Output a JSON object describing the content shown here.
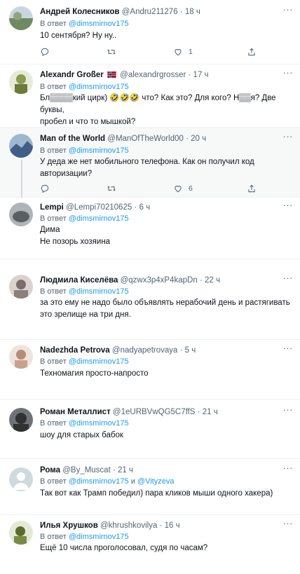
{
  "reply_to_label": "В ответ",
  "tweets": [
    {
      "name": "Андрей Колесников",
      "handle": "@Andru211276",
      "time": "18 ч",
      "reply_to": [
        "@dimsmirnov175"
      ],
      "lines": [
        "10 сентября? Ну ну.."
      ],
      "likes": "1",
      "avatar_colors": [
        "#6f8a62",
        "#c9d6e0"
      ]
    },
    {
      "name": "Alexandr Großer",
      "handle": "@alexandrgrosser",
      "time": "17 ч",
      "reply_to": [
        "@dimsmirnov175"
      ],
      "lines": [
        "Бл▒▒▒▒кий цирк) 🤣🤣🤣 что? Как это? Для кого? Н▒▒я? Две буквы,",
        "пробел и что то мышкой?"
      ],
      "likes": "",
      "avatar_colors": [
        "#8a9a4e",
        "#e6ebd8"
      ]
    },
    {
      "name": "Man of the World",
      "handle": "@ManOfTheWorld00",
      "time": "20 ч",
      "reply_to": [
        "@dimsmirnov175"
      ],
      "lines": [
        "У деда же нет мобильного телефона. Как он получил код",
        "авторизации?"
      ],
      "likes": "6",
      "avatar_colors": [
        "#3f5f86",
        "#9fb7d1"
      ]
    },
    {
      "name": "Lempi",
      "handle": "@Lempi70210625",
      "time": "6 ч",
      "reply_to": [
        "@dimsmirnov175"
      ],
      "lines": [
        "Дима",
        "Не позорь хозяина"
      ],
      "likes": "",
      "avatar_colors": [
        "#5a5f63",
        "#aeb4b8"
      ]
    },
    {
      "name": "Людмила Киселёва",
      "handle": "@qzwx3p4xP4kapDn",
      "time": "22 ч",
      "reply_to": [
        "@dimsmirnov175"
      ],
      "lines": [
        "за это ему не надо было объявлять нерабочий день и растягивать",
        "это зрелище на три дня."
      ],
      "likes": "",
      "avatar_colors": [
        "#7b6e68",
        "#d9d2cf"
      ]
    },
    {
      "name": "Nadezhda Petrova",
      "handle": "@nadyapetrovaya",
      "time": "5 ч",
      "reply_to": [
        "@dimsmirnov175"
      ],
      "lines": [
        "Техномагия просто-напросто"
      ],
      "likes": "",
      "avatar_colors": [
        "#b98a78",
        "#efe3dd"
      ]
    },
    {
      "name": "Роман Металлист",
      "handle": "@1eURBVwQG5C7ffS",
      "time": "21 ч",
      "reply_to": [
        "@dimsmirnov175"
      ],
      "lines": [
        "шоу для старых бабок"
      ],
      "likes": "",
      "avatar_colors": [
        "#2f3133",
        "#6f7377"
      ]
    },
    {
      "name": "Рома",
      "handle": "@By_Muscat",
      "time": "21 ч",
      "reply_to": [
        "@dimsmirnov175",
        "@Vityzeva"
      ],
      "and_label": "и",
      "lines": [
        "Так вот как Трамп победил)  пара кликов мыши одного хакера)"
      ],
      "likes": "",
      "avatar_colors": [
        "#cfd9de",
        "#ffffff"
      ]
    },
    {
      "name": "Илья Хрушков",
      "handle": "@khrushkovilya",
      "time": "16 ч",
      "reply_to": [
        "@dimsmirnov175"
      ],
      "lines": [
        "Ещё 10 числа проголосовал, судя по часам?"
      ],
      "likes": "",
      "avatar_colors": [
        "#5b6b2e",
        "#e4e8d6"
      ]
    }
  ],
  "colors": {
    "link": "#1d9bf0",
    "muted": "#536471",
    "highlight_bg": "#f7f9f9",
    "border": "#eff3f4"
  },
  "icons": [
    "more-icon",
    "reply-icon",
    "retweet-icon",
    "like-icon",
    "share-icon",
    "flag-norway-icon",
    "default-avatar-icon"
  ]
}
